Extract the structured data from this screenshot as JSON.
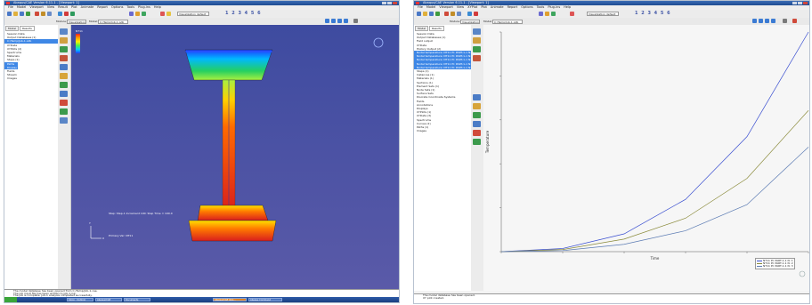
{
  "left_window": {
    "title": "Abaqus/CAE Version 6.11-1 - [Viewport: 1]",
    "menu": [
      "File",
      "Model",
      "Viewport",
      "View",
      "Result",
      "Plot",
      "Animate",
      "Report",
      "Options",
      "Tools",
      "Plug-ins",
      "Help"
    ],
    "module_label": "Module:",
    "module_value": "Visualization",
    "model_label": "Model:",
    "model_value": "C:/Temp/Job-1.odb",
    "step_numbers": "1 2 3 4 5 6",
    "tree_tabs": [
      "Model",
      "Results"
    ],
    "tree_items": [
      "Session Data",
      "Output Databases (1)",
      "C:/Temp/Job-1.odb",
      "XYData",
      "XYPlots (2)",
      "Spectrums",
      "Materials",
      "Steps (1)",
      "Paths",
      "Display Groups",
      "Fields",
      "Stream",
      "Images"
    ],
    "legend_title": "NT11",
    "view_caption": "Step: Step-1   Increment 100: Step Time = 100.0",
    "view_caption2": "Primary Var: NT11",
    "messages": [
      "The model database has been opened from C:/Temp/Job-1.cae.",
      "The job input file has been written to Job-1.inp.",
      "The job is complete. Job-1 analysis completed successfully.",
      "Output database opened for results display."
    ],
    "taskbar": [
      "start",
      "Inbox - Outlook",
      "Abaqus/CAE",
      "Documents",
      "Abaqus/CAE Vers...",
      "Abaqus Command"
    ],
    "colors": {
      "viewport_top": "#3e4ba0",
      "viewport_bottom": "#5a5aa8"
    }
  },
  "right_window": {
    "title": "Abaqus/CAE Version 6.11-1 - [Viewport: 1]",
    "menu": [
      "File",
      "Model",
      "Viewport",
      "View",
      "XYPlot",
      "Plot",
      "Animate",
      "Report",
      "Options",
      "Tools",
      "Plug-ins",
      "Help"
    ],
    "module_label": "Module:",
    "module_value": "Visualization",
    "model_label": "Model:",
    "model_value": "C:/Temp/Job-1.odb",
    "step_numbers": "1 2 3 4 5 6",
    "tree_tabs": [
      "Model",
      "Results"
    ],
    "tree_items": [
      "Session Data",
      "Output Databases (1)",
      "Field output",
      "XYData",
      "History Output (2)",
      "Nodal temperature: NT11 PI: PART-1-1 N: 1",
      "Nodal temperature: NT11 PI: PART-1-1 N: 2",
      "Nodal temperature: NT11 PI: PART-1-1 N: 3",
      "Nodal temperature: NT11 PI: PART-1-1 N: 4",
      "Nodal temperature: NT11 PI: PART-1-1 N: 5",
      "Steps (1)",
      "Instances (1)",
      "Materials (1)",
      "Sections (1)",
      "Element Sets (1)",
      "Node Sets (1)",
      "Surface Sets",
      "Discrete Coordinate Systems",
      "Fields",
      "Annotations",
      "Displays",
      "XYPlots (1)",
      "XYData (3)",
      "Spectrums",
      "Curves (2)",
      "Paths (1)",
      "Images"
    ],
    "chart_xlabel": "Time",
    "chart_ylabel": "Temperature",
    "legend_entries": [
      "NT11 PI: PART-1-1 N: 1",
      "NT11 PI: PART-1-1 N: 2",
      "NT11 PI: PART-1-1 N: 3"
    ],
    "messages": [
      "The model database has been opened.",
      "XY plot created."
    ],
    "colors": {
      "curve_blue": "#3a4fd0",
      "curve_olive": "#8a8a3a",
      "curve_steel": "#5b7bb3"
    }
  },
  "chart_data": {
    "type": "line",
    "xlabel": "Time",
    "ylabel": "Temperature",
    "x": [
      0,
      20,
      40,
      60,
      80,
      100
    ],
    "series": [
      {
        "name": "NT11 PI: PART-1-1 N: 1",
        "values": [
          0,
          3,
          17,
          50,
          110,
          210
        ]
      },
      {
        "name": "NT11 PI: PART-1-1 N: 2",
        "values": [
          0,
          2,
          12,
          32,
          70,
          135
        ]
      },
      {
        "name": "NT11 PI: PART-1-1 N: 3",
        "values": [
          0,
          1,
          7,
          20,
          45,
          100
        ]
      }
    ],
    "ylim": [
      0,
      210
    ],
    "xlim": [
      0,
      100
    ],
    "grid": false,
    "legend_position": "bottom-right"
  }
}
